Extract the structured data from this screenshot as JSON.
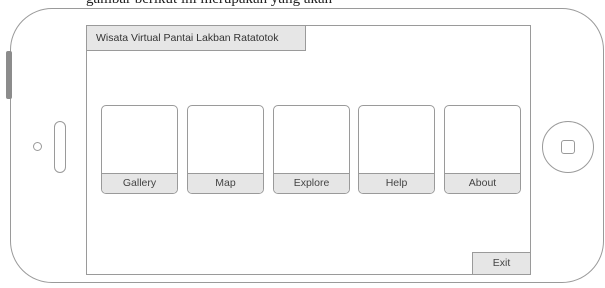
{
  "caption": "gambar berikut ini merupakan yang akan",
  "app": {
    "title": "Wisata Virtual Pantai Lakban Ratatotok"
  },
  "menu": {
    "items": [
      {
        "label": "Gallery"
      },
      {
        "label": "Map"
      },
      {
        "label": "Explore"
      },
      {
        "label": "Help"
      },
      {
        "label": "About"
      }
    ]
  },
  "footer": {
    "exit_label": "Exit"
  },
  "colors": {
    "frame_stroke": "#9a9a9a",
    "bar_fill": "#e6e6e6"
  }
}
